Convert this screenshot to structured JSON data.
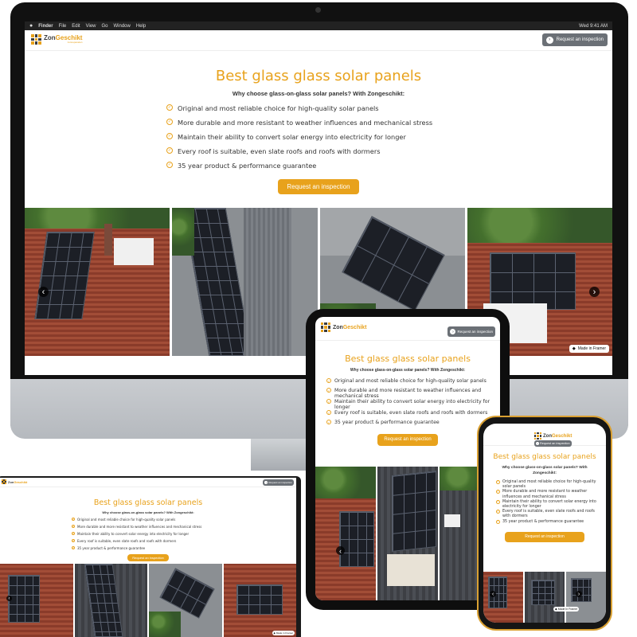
{
  "menubar": {
    "items": [
      "Finder",
      "File",
      "Edit",
      "View",
      "Go",
      "Window",
      "Help"
    ],
    "clock": "Wed 9:41 AM"
  },
  "logo": {
    "part1": "Zon",
    "part2": "Geschikt",
    "tagline": "zonnepanelen"
  },
  "header": {
    "button_label": "Request an inspection"
  },
  "hero": {
    "title": "Best glass glass solar panels",
    "subtitle": "Why choose glass-on-glass solar panels? With Zongeschikt:",
    "features": [
      "Original and most reliable choice for high-quality solar panels",
      "More durable and more resistant to weather influences and mechanical stress",
      "Maintain their ability to convert solar energy into electricity for longer",
      "Every roof is suitable, even slate roofs and roofs with dormers",
      "35 year product & performance guarantee"
    ],
    "cta": "Request an inspection"
  },
  "badge": {
    "label": "Made in Framer"
  },
  "icons": {
    "check": "check-icon",
    "arrow_left": "‹",
    "arrow_right": "›"
  },
  "colors": {
    "accent": "#e8a21c",
    "header_button": "#6b7076"
  }
}
